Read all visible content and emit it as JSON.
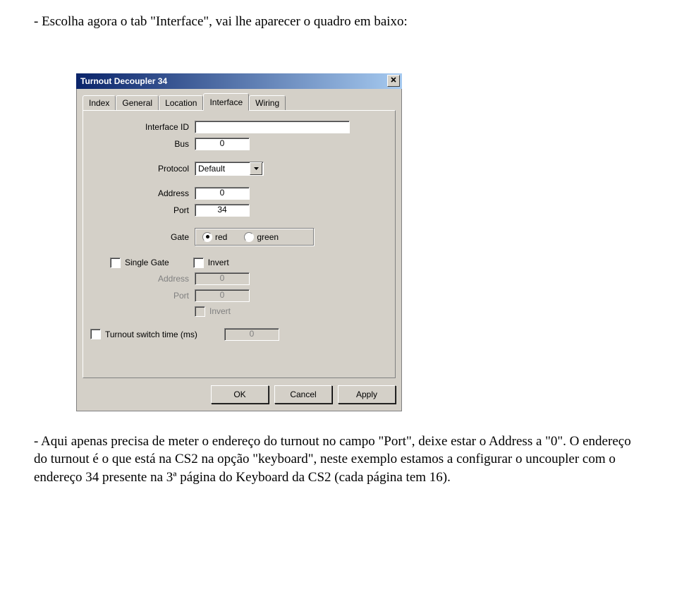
{
  "doc": {
    "para1": "- Escolha agora o tab \"Interface\", vai lhe aparecer o quadro em baixo:",
    "para2": "- Aqui apenas precisa de meter o endereço do turnout no campo \"Port\", deixe estar o Address a \"0\". O endereço do turnout é o que está na CS2 na opção \"keyboard\", neste exemplo estamos a configurar o uncoupler com o endereço 34 presente na 3ª página do Keyboard da CS2 (cada página tem 16)."
  },
  "dialog": {
    "title": "Turnout Decoupler 34",
    "tabs": [
      "Index",
      "General",
      "Location",
      "Interface",
      "Wiring"
    ],
    "active_tab": 3,
    "labels": {
      "interface_id": "Interface ID",
      "bus": "Bus",
      "protocol": "Protocol",
      "address": "Address",
      "port": "Port",
      "gate": "Gate",
      "single_gate": "Single Gate",
      "invert": "Invert",
      "address2": "Address",
      "port2": "Port",
      "invert2": "Invert",
      "switch_time": "Turnout switch time (ms)"
    },
    "values": {
      "interface_id": "",
      "bus": "0",
      "protocol": "Default",
      "address": "0",
      "port": "34",
      "gate_red": "red",
      "gate_green": "green",
      "gate_selected": "red",
      "address2": "0",
      "port2": "0",
      "switch_time": "0"
    },
    "buttons": {
      "ok": "OK",
      "cancel": "Cancel",
      "apply": "Apply"
    }
  }
}
